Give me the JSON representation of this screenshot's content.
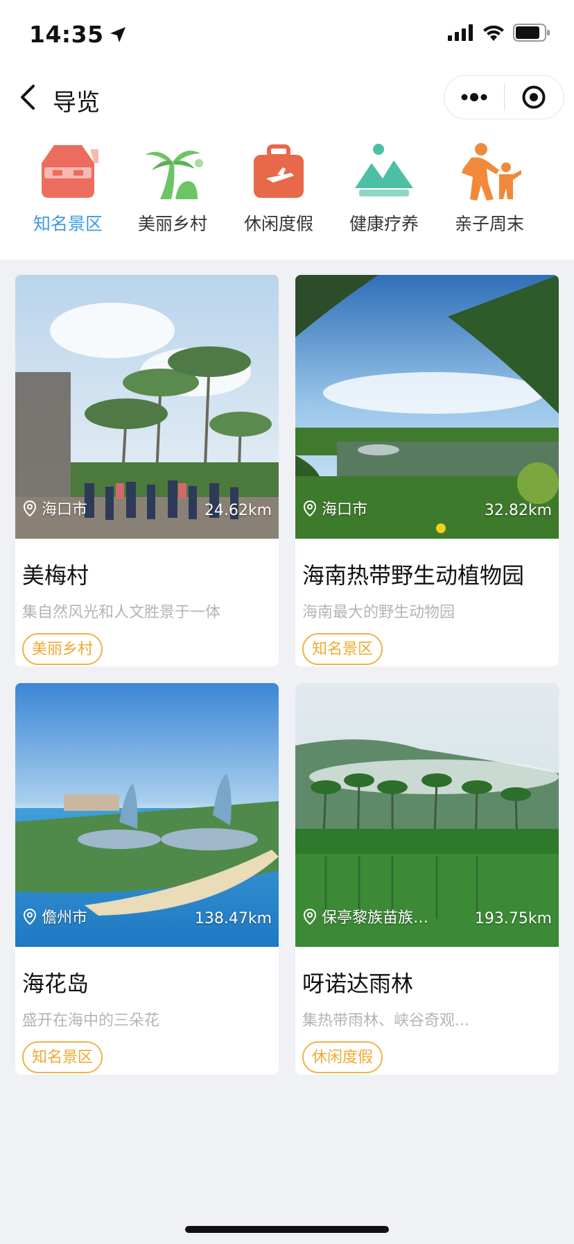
{
  "status": {
    "time": "14:35"
  },
  "nav": {
    "title": "导览"
  },
  "categories": [
    {
      "label": "知名景区",
      "icon": "scenic-area-icon",
      "color": "#ec6d5e",
      "active": true
    },
    {
      "label": "美丽乡村",
      "icon": "palm-tree-icon",
      "color": "#6dc463",
      "active": false
    },
    {
      "label": "休闲度假",
      "icon": "suitcase-icon",
      "color": "#e8684a",
      "active": false
    },
    {
      "label": "健康疗养",
      "icon": "mountain-icon",
      "color": "#4dbfa4",
      "active": false
    },
    {
      "label": "亲子周末",
      "icon": "parent-child-icon",
      "color": "#f08a3a",
      "active": false
    }
  ],
  "places": [
    {
      "name": "美梅村",
      "desc": "集自然风光和人文胜景于一体",
      "city": "海口市",
      "distance": "24.62km",
      "tag": "美丽乡村"
    },
    {
      "name": "海南热带野生动植物园",
      "desc": "海南最大的野生动物园",
      "city": "海口市",
      "distance": "32.82km",
      "tag": "知名景区"
    },
    {
      "name": "海花岛",
      "desc": "盛开在海中的三朵花",
      "city": "儋州市",
      "distance": "138.47km",
      "tag": "知名景区"
    },
    {
      "name": "呀诺达雨林",
      "desc": "集热带雨林、峡谷奇观...",
      "city": "保亭黎族苗族…",
      "distance": "193.75km",
      "tag": "休闲度假"
    }
  ],
  "colors": {
    "active": "#3a9ae0",
    "tag": "#f0a830",
    "background": "#f0f1f5"
  }
}
